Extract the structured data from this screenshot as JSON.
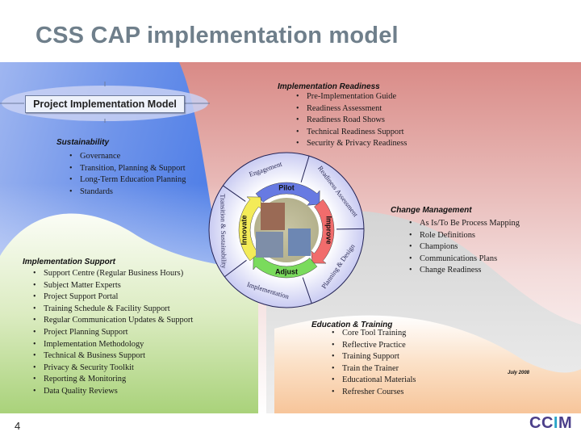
{
  "slide": {
    "title": "CSS CAP implementation model",
    "page_number": "4",
    "date": "July 2008",
    "logo": {
      "prefix": "CC",
      "accent": "I",
      "suffix": "M",
      "color": "#4b3f8a",
      "accent_color": "#2aa6c9"
    }
  },
  "model_label": "Project Implementation Model",
  "sections": {
    "implementation_readiness": {
      "heading": "Implementation Readiness",
      "items": [
        "Pre-Implementation Guide",
        "Readiness Assessment",
        "Readiness Road Shows",
        "Technical Readiness Support",
        "Security & Privacy Readiness"
      ]
    },
    "sustainability": {
      "heading": "Sustainability",
      "items": [
        "Governance",
        "Transition, Planning & Support",
        "Long-Term Education Planning",
        "Standards"
      ]
    },
    "change_management": {
      "heading": "Change Management",
      "items": [
        "As Is/To Be Process Mapping",
        "Role Definitions",
        "Champions",
        "Communications Plans",
        "Change Readiness"
      ]
    },
    "implementation_support": {
      "heading": "Implementation Support",
      "items": [
        "Support Centre (Regular Business Hours)",
        "Subject Matter Experts",
        "Project Support Portal",
        "Training Schedule & Facility Support",
        "Regular Communication Updates & Support",
        "Project Planning Support",
        "Implementation Methodology",
        "Technical & Business Support",
        "Privacy & Security Toolkit",
        "Reporting & Monitoring",
        "Data Quality Reviews"
      ]
    },
    "education_training": {
      "heading": "Education & Training",
      "items": [
        "Core Tool Training",
        "Reflective Practice",
        "Training Support",
        "Train the Trainer",
        "Educational Materials",
        "Refresher Courses"
      ]
    }
  },
  "wheel": {
    "outer_segments": [
      "Engagement",
      "Readiness Assessment",
      "Planning & Design",
      "Implementation",
      "Transition & Sustainability"
    ],
    "cycle": [
      {
        "label": "Pilot",
        "color": "#5b6fe0"
      },
      {
        "label": "Improve",
        "color": "#f06060"
      },
      {
        "label": "Adjust",
        "color": "#6fd84f"
      },
      {
        "label": "Innovate",
        "color": "#f3ea4a"
      }
    ]
  },
  "colors": {
    "title": "#6f7f8b",
    "blue_region": "#4f7fe6",
    "red_region": "#d98a86",
    "green_region": "#a8d07a",
    "orange_region": "#f7c59a",
    "grey_region": "#c8c8c8"
  }
}
